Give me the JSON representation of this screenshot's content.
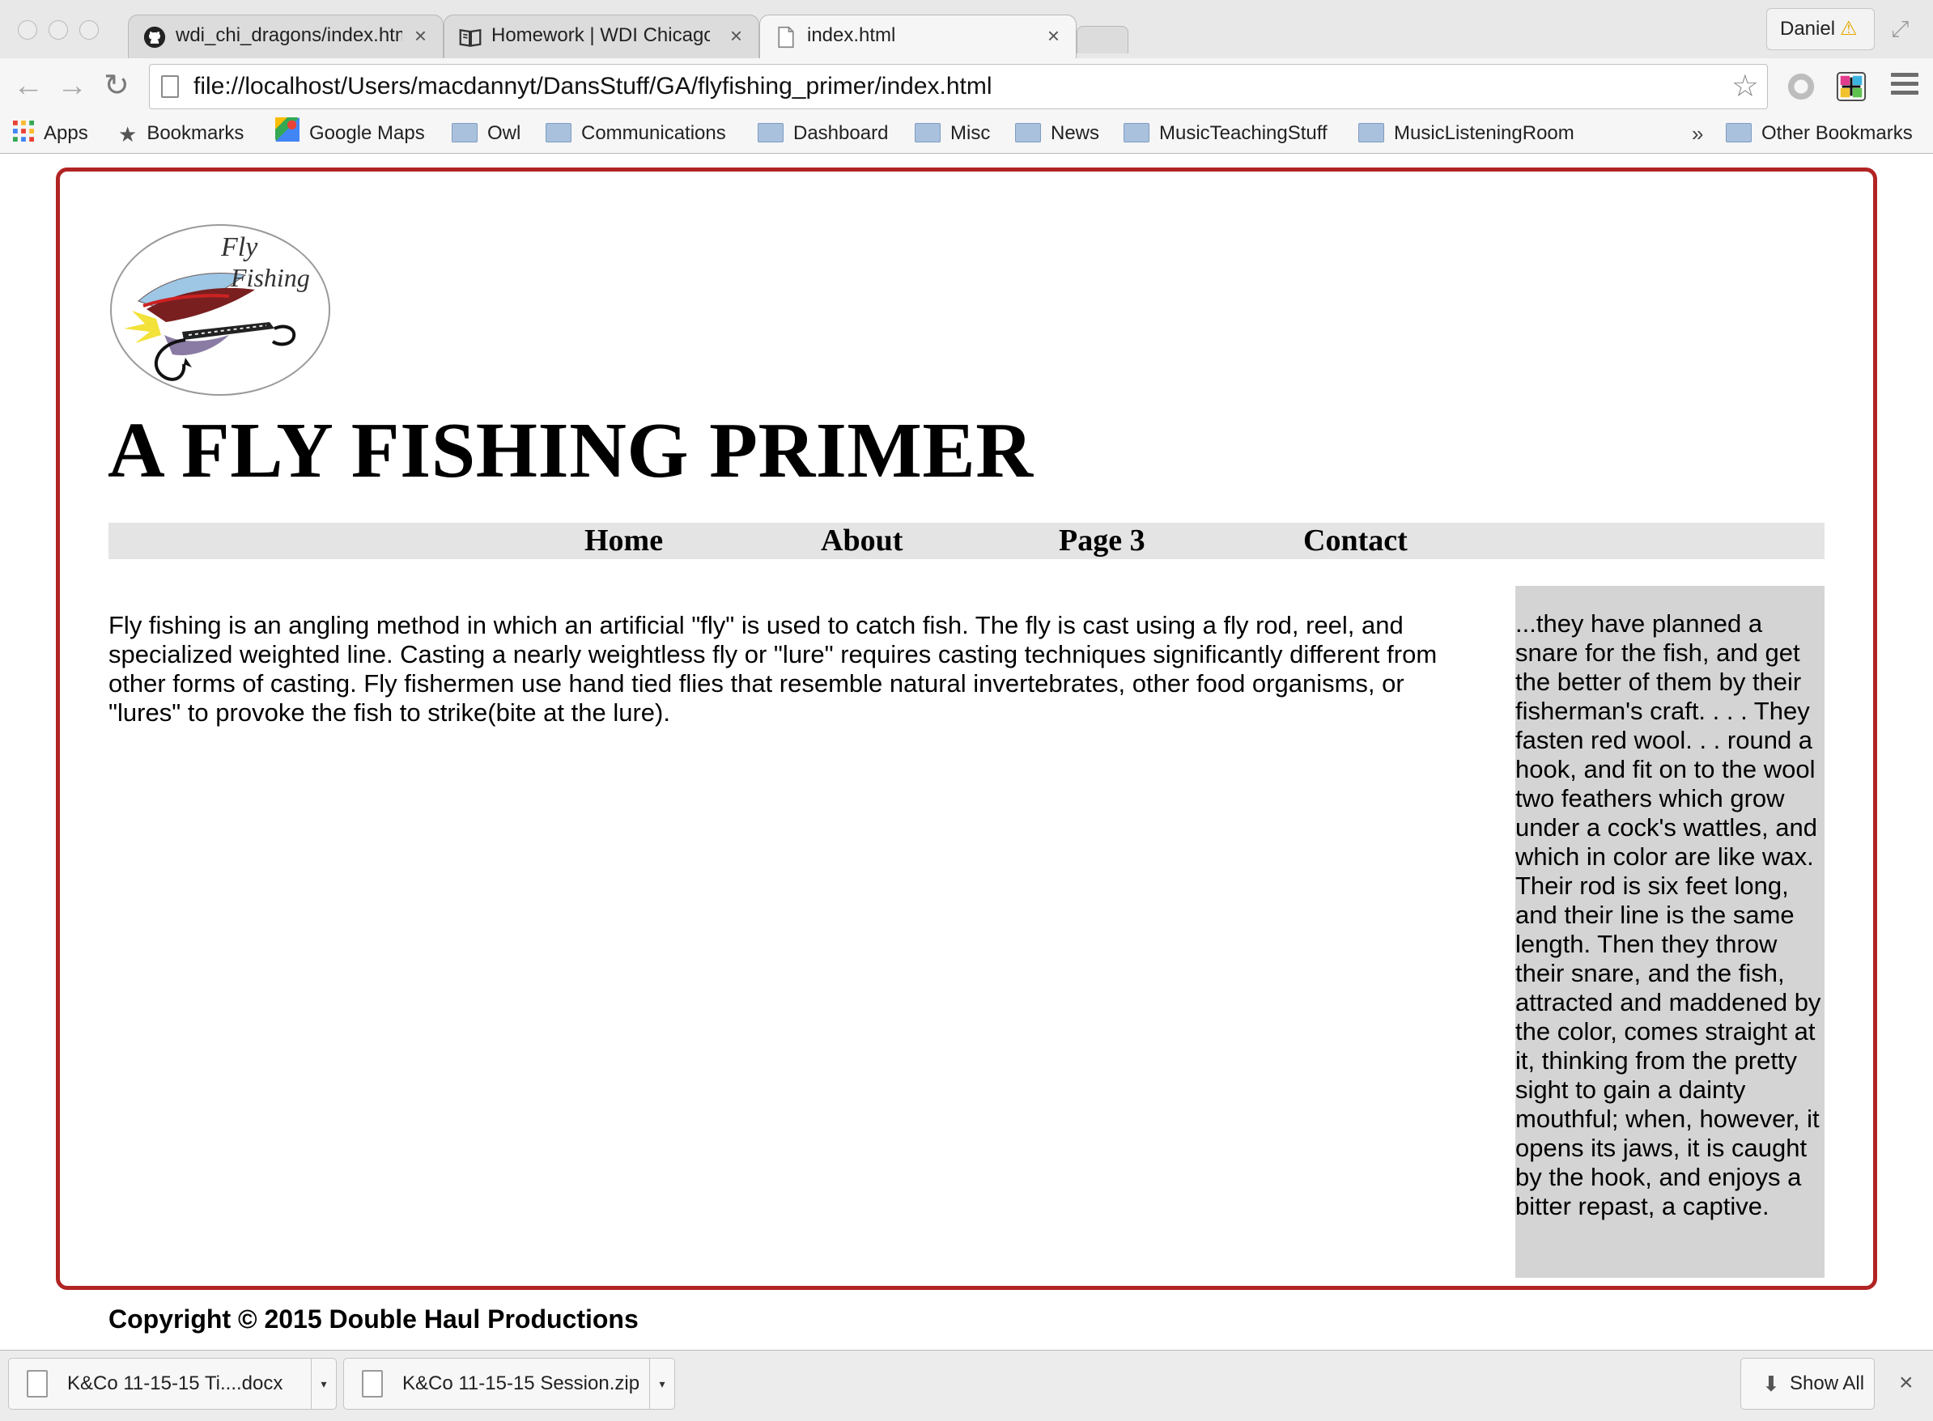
{
  "browser": {
    "tabs": [
      {
        "title": "wdi_chi_dragons/index.htm",
        "icon": "github-icon",
        "active": false
      },
      {
        "title": "Homework | WDI Chicago",
        "icon": "book-icon",
        "active": false
      },
      {
        "title": "index.html",
        "icon": "page-icon",
        "active": true
      }
    ],
    "tab_close_glyph": "×",
    "profile": {
      "name": "Daniel",
      "warning_glyph": "⚠"
    },
    "address": "file://localhost/Users/macdannyt/DansStuff/GA/flyfishing_primer/index.html",
    "bookmarks": [
      {
        "label": "Apps",
        "icon": "apps-grid-icon"
      },
      {
        "label": "Bookmarks",
        "icon": "star-icon"
      },
      {
        "label": "Google Maps",
        "icon": "maps-icon"
      },
      {
        "label": "Owl",
        "icon": "folder-icon"
      },
      {
        "label": "Communications",
        "icon": "folder-icon"
      },
      {
        "label": "Dashboard",
        "icon": "folder-icon"
      },
      {
        "label": "Misc",
        "icon": "folder-icon"
      },
      {
        "label": "News",
        "icon": "folder-icon"
      },
      {
        "label": "MusicTeachingStuff",
        "icon": "folder-icon"
      },
      {
        "label": "MusicListeningRoom",
        "icon": "folder-icon"
      }
    ],
    "bookmarks_overflow": "»",
    "other_bookmarks": "Other Bookmarks"
  },
  "page": {
    "logo_text": [
      "Fly",
      "Fishing"
    ],
    "title": "A FLY FISHING PRIMER",
    "nav": [
      "Home",
      "About",
      "Page 3",
      "Contact"
    ],
    "main_text": "Fly fishing is an angling method in which an artificial \"fly\" is used to catch fish. The fly is cast using a fly rod, reel, and specialized weighted line. Casting a nearly weightless fly or \"lure\" requires casting techniques significantly different from other forms of casting. Fly fishermen use hand tied flies that resemble natural invertebrates, other food organisms, or \"lures\" to provoke the fish to strike(bite at the lure).",
    "aside_text": "...they have planned a snare for the fish, and get the better of them by their fisherman's craft. . . . They fasten red wool. . . round a hook, and fit on to the wool two feathers which grow under a cock's wattles, and which in color are like wax. Their rod is six feet long, and their line is the same length. Then they throw their snare, and the fish, attracted and maddened by the color, comes straight at it, thinking from the pretty sight to gain a dainty mouthful; when, however, it opens its jaws, it is caught by the hook, and enjoys a bitter repast, a captive.",
    "footer": "Copyright © 2015 Double Haul Productions",
    "border_color": "#b12424",
    "nav_bg": "#e4e4e4",
    "aside_bg": "#d4d4d4"
  },
  "downloads": {
    "items": [
      "K&Co 11-15-15 Ti....docx",
      "K&Co 11-15-15 Session.zip"
    ],
    "dropdown_glyph": "▾",
    "show_all": "Show All",
    "close_glyph": "×"
  }
}
